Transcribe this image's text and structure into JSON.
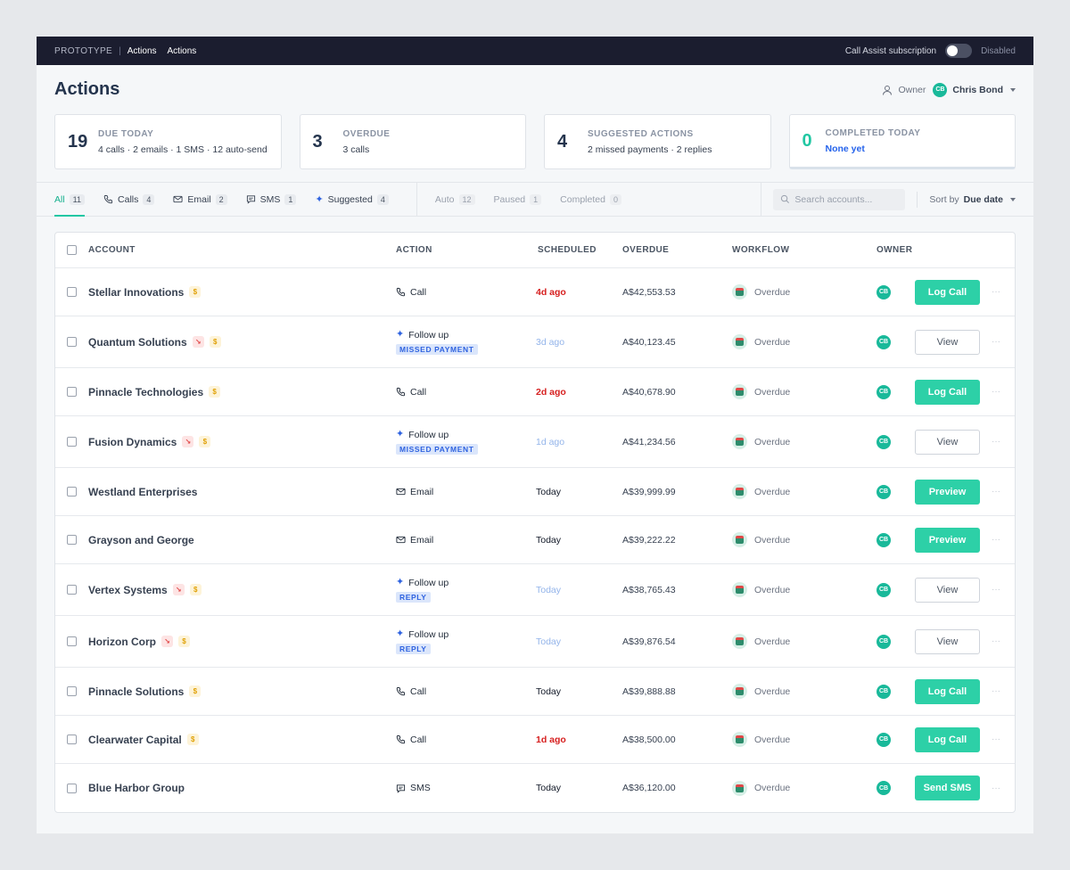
{
  "topbar": {
    "brand": "PROTOTYPE",
    "separator": "|",
    "crumbs": [
      "Actions",
      "Actions"
    ],
    "subscription_label": "Call Assist subscription",
    "subscription_state": "Disabled"
  },
  "header": {
    "title": "Actions",
    "owner_label": "Owner",
    "owner_initials": "CB",
    "owner_name": "Chris Bond"
  },
  "cards": [
    {
      "num": "19",
      "label": "DUE TODAY",
      "sub": "4 calls · 2 emails · 1 SMS · 12 auto-send"
    },
    {
      "num": "3",
      "label": "OVERDUE",
      "sub": "3 calls"
    },
    {
      "num": "4",
      "label": "SUGGESTED ACTIONS",
      "sub": "2 missed payments · 2 replies"
    },
    {
      "num": "0",
      "label": "COMPLETED TODAY",
      "sub": "None yet"
    }
  ],
  "tabs": {
    "primary": [
      {
        "label": "All",
        "count": "11"
      },
      {
        "label": "Calls",
        "count": "4"
      },
      {
        "label": "Email",
        "count": "2"
      },
      {
        "label": "SMS",
        "count": "1"
      },
      {
        "label": "Suggested",
        "count": "4"
      }
    ],
    "secondary": [
      {
        "label": "Auto",
        "count": "12"
      },
      {
        "label": "Paused",
        "count": "1"
      },
      {
        "label": "Completed",
        "count": "0"
      }
    ],
    "search_placeholder": "Search accounts...",
    "sort_label": "Sort by",
    "sort_value": "Due date"
  },
  "table": {
    "headers": {
      "account": "ACCOUNT",
      "action": "ACTION",
      "scheduled": "SCHEDULED",
      "overdue": "OVERDUE",
      "workflow": "WORKFLOW",
      "owner": "OWNER"
    },
    "rows": [
      {
        "account": "Stellar Innovations",
        "trend": false,
        "action": "Call",
        "action_icon": "phone-icon",
        "pill": "",
        "scheduled": "4d ago",
        "sched_style": "red",
        "overdue": "A$42,553.53",
        "workflow": "Overdue",
        "owner": "CB",
        "button": "Log Call",
        "button_style": "primary",
        "more": "···"
      },
      {
        "account": "Quantum Solutions",
        "trend": true,
        "action": "Follow up",
        "action_icon": "sparkle-icon",
        "pill": "MISSED PAYMENT",
        "scheduled": "3d ago",
        "sched_style": "light",
        "overdue": "A$40,123.45",
        "workflow": "Overdue",
        "owner": "CB",
        "button": "View",
        "button_style": "outline",
        "more": "···"
      },
      {
        "account": "Pinnacle Technologies",
        "trend": false,
        "action": "Call",
        "action_icon": "phone-icon",
        "pill": "",
        "scheduled": "2d ago",
        "sched_style": "red",
        "overdue": "A$40,678.90",
        "workflow": "Overdue",
        "owner": "CB",
        "button": "Log Call",
        "button_style": "primary",
        "more": "···"
      },
      {
        "account": "Fusion Dynamics",
        "trend": true,
        "action": "Follow up",
        "action_icon": "sparkle-icon",
        "pill": "MISSED PAYMENT",
        "scheduled": "1d ago",
        "sched_style": "light",
        "overdue": "A$41,234.56",
        "workflow": "Overdue",
        "owner": "CB",
        "button": "View",
        "button_style": "outline",
        "more": "···"
      },
      {
        "account": "Westland Enterprises",
        "trend": false,
        "dollar": false,
        "action": "Email",
        "action_icon": "mail-icon",
        "pill": "",
        "scheduled": "Today",
        "sched_style": "dark",
        "overdue": "A$39,999.99",
        "workflow": "Overdue",
        "owner": "CB",
        "button": "Preview",
        "button_style": "primary",
        "more": "···"
      },
      {
        "account": "Grayson and George",
        "trend": false,
        "dollar": false,
        "action": "Email",
        "action_icon": "mail-icon",
        "pill": "",
        "scheduled": "Today",
        "sched_style": "dark",
        "overdue": "A$39,222.22",
        "workflow": "Overdue",
        "owner": "CB",
        "button": "Preview",
        "button_style": "primary",
        "more": "···"
      },
      {
        "account": "Vertex Systems",
        "trend": true,
        "action": "Follow up",
        "action_icon": "sparkle-icon",
        "pill": "REPLY",
        "scheduled": "Today",
        "sched_style": "light",
        "overdue": "A$38,765.43",
        "workflow": "Overdue",
        "owner": "CB",
        "button": "View",
        "button_style": "outline",
        "more": "···"
      },
      {
        "account": "Horizon Corp",
        "trend": true,
        "action": "Follow up",
        "action_icon": "sparkle-icon",
        "pill": "REPLY",
        "scheduled": "Today",
        "sched_style": "light",
        "overdue": "A$39,876.54",
        "workflow": "Overdue",
        "owner": "CB",
        "button": "View",
        "button_style": "outline",
        "more": "···"
      },
      {
        "account": "Pinnacle Solutions",
        "trend": false,
        "action": "Call",
        "action_icon": "phone-icon",
        "pill": "",
        "scheduled": "Today",
        "sched_style": "dark",
        "overdue": "A$39,888.88",
        "workflow": "Overdue",
        "owner": "CB",
        "button": "Log Call",
        "button_style": "primary",
        "more": "···"
      },
      {
        "account": "Clearwater Capital",
        "trend": false,
        "action": "Call",
        "action_icon": "phone-icon",
        "pill": "",
        "scheduled": "1d ago",
        "sched_style": "red",
        "overdue": "A$38,500.00",
        "workflow": "Overdue",
        "owner": "CB",
        "button": "Log Call",
        "button_style": "primary",
        "more": "···"
      },
      {
        "account": "Blue Harbor Group",
        "trend": false,
        "dollar": false,
        "action": "SMS",
        "action_icon": "sms-icon",
        "pill": "",
        "scheduled": "Today",
        "sched_style": "dark",
        "overdue": "A$36,120.00",
        "workflow": "Overdue",
        "owner": "CB",
        "button": "Send SMS",
        "button_style": "primary",
        "more": "···"
      }
    ]
  },
  "colors": {
    "accent": "#2dd0a7",
    "topbar": "#1b1d2f",
    "danger": "#d61f1f",
    "link": "#2563eb"
  }
}
